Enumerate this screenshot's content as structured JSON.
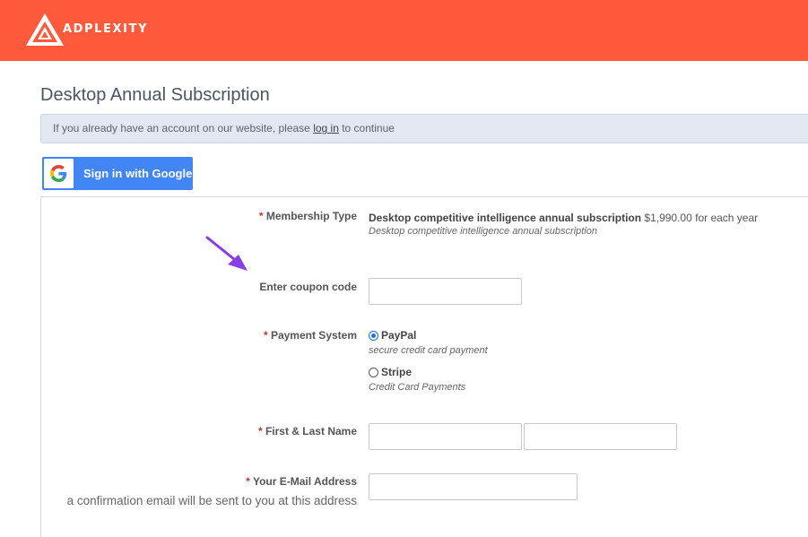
{
  "brand": {
    "name": "ADPLEXITY",
    "accent": "#ff5a3c"
  },
  "page": {
    "title": "Desktop Annual Subscription"
  },
  "notice": {
    "before": "If you already have an account on our website, please ",
    "link": "log in",
    "after": " to continue"
  },
  "google": {
    "label": "Sign in with Google",
    "icon": "google-g-icon",
    "color": "#4285f4"
  },
  "form": {
    "membership": {
      "required": "*",
      "label": "Membership Type",
      "name": "Desktop competitive intelligence annual subscription",
      "price": " $1,990.00 for each year",
      "description": "Desktop competitive intelligence annual subscription"
    },
    "coupon": {
      "label": "Enter coupon code",
      "value": ""
    },
    "payment": {
      "required": "*",
      "label": "Payment System",
      "options": [
        {
          "name": "PayPal",
          "note": "secure credit card payment",
          "selected": true
        },
        {
          "name": "Stripe",
          "note": "Credit Card Payments",
          "selected": false
        }
      ]
    },
    "name": {
      "required": "*",
      "label": "First & Last Name",
      "first": "",
      "last": ""
    },
    "email": {
      "required": "*",
      "label": "Your E-Mail Address",
      "hint": "a confirmation email will be sent to you at this address",
      "value": ""
    }
  },
  "annotation": {
    "arrow_color": "#8a3ee8",
    "icon": "arrow-pointer-icon"
  }
}
